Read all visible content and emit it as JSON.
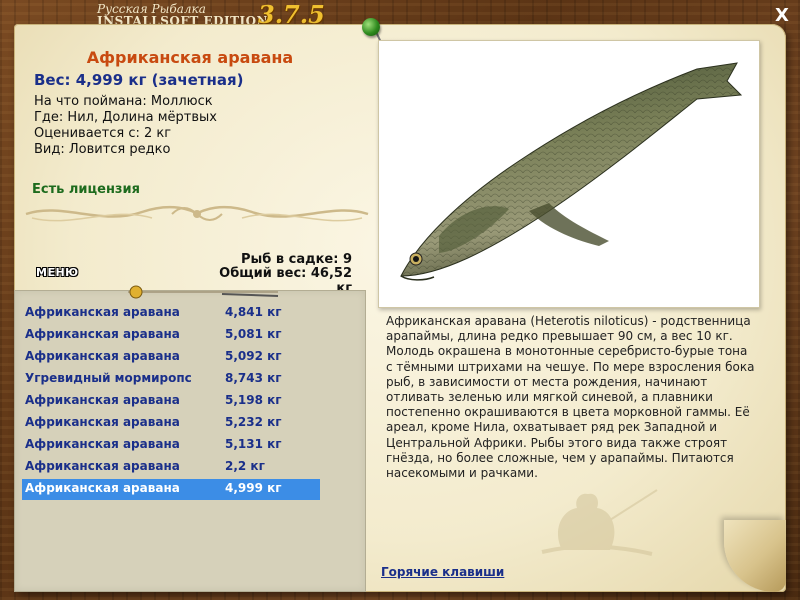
{
  "titlebar": {
    "line1": "Русская Рыбалка",
    "line2": "INSTALLSOFT EDITION",
    "version": "3.7.5",
    "close_label": "X"
  },
  "fish": {
    "name": "Африканская аравана",
    "weight": "Вес: 4,999 кг (зачетная)",
    "bait": "На что поймана: Моллюск",
    "place": "Где: Нил, Долина мёртвых",
    "rated_from": "Оценивается с: 2 кг",
    "kind": "Вид: Ловится редко",
    "license": "Есть лицензия"
  },
  "keepnet": {
    "count": "Рыб в садке: 9",
    "total": "Общий вес: 46,52 кг"
  },
  "menu_button": "МЕНЮ",
  "catches": [
    {
      "name": "Африканская аравана",
      "weight": "4,841 кг",
      "selected": false
    },
    {
      "name": "Африканская аравана",
      "weight": "5,081 кг",
      "selected": false
    },
    {
      "name": "Африканская аравана",
      "weight": "5,092 кг",
      "selected": false
    },
    {
      "name": "Угревидный мормиропс",
      "weight": "8,743 кг",
      "selected": false
    },
    {
      "name": "Африканская аравана",
      "weight": "5,198 кг",
      "selected": false
    },
    {
      "name": "Африканская аравана",
      "weight": "5,232 кг",
      "selected": false
    },
    {
      "name": "Африканская аравана",
      "weight": "5,131 кг",
      "selected": false
    },
    {
      "name": "Африканская аравана",
      "weight": "2,2 кг",
      "selected": false
    },
    {
      "name": "Африканская аравана",
      "weight": "4,999 кг",
      "selected": true
    }
  ],
  "description": "Африканская аравана (Heterotis niloticus) - родственница арапаймы, длина редко превышает 90 см, а вес 10 кг. Молодь окрашена в монотонные серебристо-бурые тона с тёмными штрихами на чешуе. По мере взросления бока рыб, в зависимости от места рождения, начинают отливать зеленью или мягкой синевой, а плавники постепенно окрашиваются в цвета морковной гаммы. Её ареал, кроме Нила, охватывает ряд рек Западной и Центральной Африки. Рыбы этого вида также строят гнёзда, но более сложные, чем у арапаймы. Питаются насекомыми и рачками.",
  "hotkeys_link": "Горячие клавиши",
  "icons": {
    "pin": "green-pushpin-icon",
    "close": "close-icon",
    "fish": "arawana-fish-photo",
    "watermark": "fisherman-logo-icon"
  },
  "colors": {
    "fish_name": "#c84a10",
    "weight": "#1a2f8a",
    "license": "#1d6b1d",
    "selection": "#3c8de6",
    "version": "#f0c030"
  }
}
